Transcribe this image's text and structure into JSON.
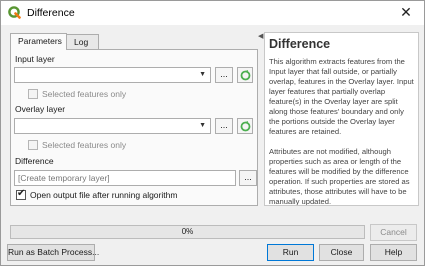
{
  "window": {
    "title": "Difference",
    "close": "✕"
  },
  "tabs": [
    {
      "label": "Parameters"
    },
    {
      "label": "Log"
    }
  ],
  "params": {
    "input_layer_label": "Input layer",
    "input_selected_only": "Selected features only",
    "overlay_layer_label": "Overlay layer",
    "overlay_selected_only": "Selected features only",
    "difference_label": "Difference",
    "difference_placeholder": "[Create temporary layer]",
    "open_output_label": "Open output file after running algorithm",
    "open_output_checked": true,
    "dots": "..."
  },
  "help": {
    "title": "Difference",
    "paragraph1": "This algorithm extracts features from the Input layer that fall outside, or partially overlap, features in the Overlay layer. Input layer features that partially overlap feature(s) in the Overlay layer are split along those features' boundary and only the portions outside the Overlay layer features are retained.",
    "paragraph2": "Attributes are not modified, although properties such as area or length of the features will be modified by the difference operation. If such properties are stored as attributes, those attributes will have to be manually updated."
  },
  "progress": {
    "value": 0,
    "text": "0%"
  },
  "buttons": {
    "cancel": "Cancel",
    "batch": "Run as Batch Process...",
    "run": "Run",
    "close": "Close",
    "help": "Help"
  },
  "colors": {
    "accent": "#0078d7",
    "qgis_green": "#589632",
    "iterate_green": "#4caf50"
  }
}
